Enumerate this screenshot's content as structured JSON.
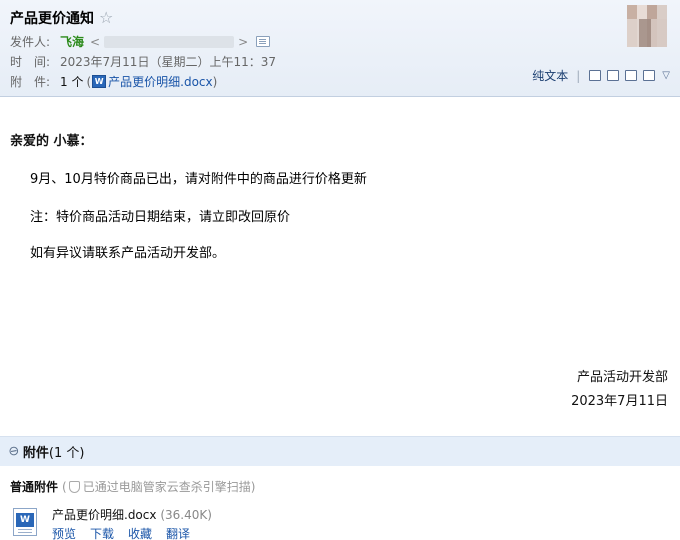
{
  "mail": {
    "subject": "产品更价通知",
    "star_icon": "☆",
    "sender_label": "发件人:",
    "sender_name": "飞海",
    "time_label": "时　间:",
    "time_value": "2023年7月11日（星期二）上午11：37",
    "attach_label": "附　件:",
    "attach_count": "1 个",
    "attach_paren_open": "(",
    "attach_paren_close": ")",
    "attach_name": "产品更价明细.docx"
  },
  "toolbar": {
    "plain_text": "纯文本",
    "sep": "|"
  },
  "body": {
    "greeting": "亲爱的 小慕：",
    "p1": "9月、10月特价商品已出，请对附件中的商品进行价格更新",
    "p2": "注：特价商品活动日期结束，请立即改回原价",
    "p3": "如有异议请联系产品活动开发部。",
    "sign_dept": "产品活动开发部",
    "sign_date": "2023年7月11日"
  },
  "attachments": {
    "title": "附件",
    "count": "(1 个)",
    "section_name": "普通附件",
    "scan_note": "已通过电脑管家云查杀引擎扫描)",
    "scan_prefix": "(",
    "file_name": "产品更价明细.docx",
    "file_size": "(36.40K)",
    "actions": [
      "预览",
      "下载",
      "收藏",
      "翻译"
    ]
  }
}
